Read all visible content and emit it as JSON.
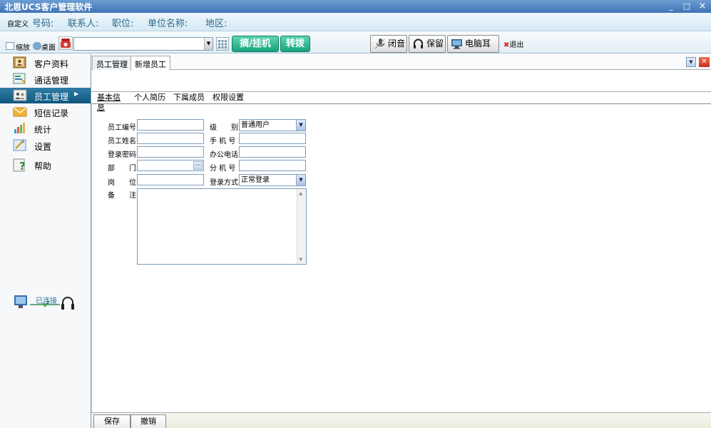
{
  "window": {
    "title": "北恩UCS客户管理软件",
    "minimize": "_",
    "maximize": "□",
    "close": "×"
  },
  "infobar": {
    "custom_label": "自定义",
    "fields": [
      "号码:",
      "联系人:",
      "职位:",
      "单位名称:",
      "地区:"
    ]
  },
  "toolbar": {
    "shrink_label": "缩放",
    "desktop_label": "桌面",
    "phone_value": "",
    "pick_hang_label": "摘/挂机",
    "transfer_label": "转拨",
    "mute_label": "闭音",
    "hold_label": "保留",
    "pc_headset_label": "电脑耳机",
    "exit_label": "退出"
  },
  "nav": {
    "items": [
      {
        "label": "客户资料",
        "icon": "contacts-book-icon"
      },
      {
        "label": "通话管理",
        "icon": "call-record-icon"
      },
      {
        "label": "员工管理",
        "icon": "staff-icon",
        "active": true
      },
      {
        "label": "短信记录",
        "icon": "envelope-icon"
      },
      {
        "label": "统计",
        "icon": "bar-chart-icon"
      },
      {
        "label": "设置",
        "icon": "settings-icon"
      },
      {
        "label": "帮助",
        "icon": "help-icon"
      }
    ],
    "connection_status": "已连接"
  },
  "main": {
    "tabs": [
      "员工管理",
      "新增员工"
    ],
    "subtabs": [
      "基本信息",
      "个人简历",
      "下属成员",
      "权限设置"
    ],
    "form": {
      "employee_id_label": "员工编号",
      "employee_name_label": "员工姓名",
      "password_label": "登录密码",
      "department_label": "部　　门",
      "position_label": "岗　　位",
      "notes_label": "备　　注",
      "level_label": "级　　别",
      "level_value": "普通用户",
      "mobile_label": "手 机 号",
      "office_phone_label": "办公电话",
      "extension_label": "分 机 号",
      "login_mode_label": "登录方式",
      "login_mode_value": "正常登录",
      "employee_id": "",
      "employee_name": "",
      "password": "",
      "department": "",
      "position": "",
      "mobile": "",
      "office_phone": "",
      "extension": "",
      "notes": ""
    },
    "buttons": {
      "save": "保存",
      "cancel": "撤销"
    }
  },
  "colors": {
    "title_bar": "#3f74b6",
    "nav_active": "#0f5880",
    "green_button": "#16a37c",
    "close_red": "#c8321b"
  }
}
